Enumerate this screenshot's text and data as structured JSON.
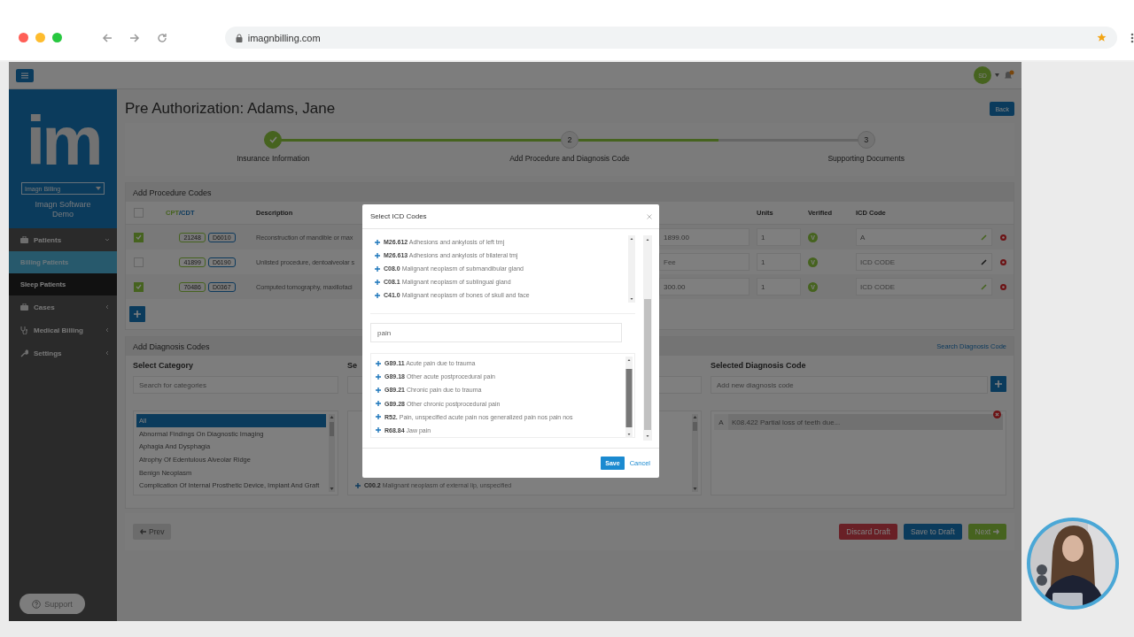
{
  "browser": {
    "url": "imagnbilling.com"
  },
  "header": {
    "initials": "SD"
  },
  "sidebar": {
    "logo": "im",
    "org_select": "Imagn Billing",
    "org_name": "Imagn Software Demo",
    "items": [
      {
        "label": "Patients",
        "expanded": true,
        "children": [
          {
            "label": "Billing Patients",
            "selected": true
          },
          {
            "label": "Sleep Patients",
            "selected": false
          }
        ]
      },
      {
        "label": "Cases",
        "expanded": false
      },
      {
        "label": "Medical Billing",
        "expanded": false
      },
      {
        "label": "Settings",
        "expanded": false
      }
    ],
    "support": "Support"
  },
  "page": {
    "title": "Pre Authorization: Adams, Jane",
    "back": "Back"
  },
  "steps": {
    "level": 0.75,
    "items": [
      {
        "label": "Insurance Information",
        "done": true
      },
      {
        "number": "2",
        "label": "Add Procedure and Diagnosis Code",
        "done": false
      },
      {
        "number": "3",
        "label": "Supporting Documents",
        "done": false
      }
    ]
  },
  "procedures": {
    "title": "Add Procedure Codes",
    "all_checked": false,
    "code_heading": {
      "cpt": "CPT",
      "cdt": "/CDT"
    },
    "columns": [
      "Description",
      "Units",
      "Verified",
      "ICD Code"
    ],
    "rows": [
      {
        "checked": true,
        "cpt": "21248",
        "cdt": "D6010",
        "description": "Reconstruction of mandible or max",
        "fee": "1899.00",
        "units": "1",
        "verified": "V",
        "icd": "A"
      },
      {
        "checked": false,
        "cpt": "41899",
        "cdt": "D6190",
        "description": "Unlisted procedure, dentoalveolar s",
        "fee_placeholder": "Fee",
        "units": "1",
        "verified": "V",
        "icd_placeholder": "ICD CODE"
      },
      {
        "checked": true,
        "cpt": "70486",
        "cdt": "D0367",
        "description": "Computed tomography, maxillofaci",
        "fee": "300.00",
        "units": "1",
        "verified": "V",
        "icd_placeholder": "ICD CODE"
      }
    ]
  },
  "diagnosis": {
    "title": "Add Diagnosis Codes",
    "search_link": "Search Diagnosis Code",
    "category": {
      "heading": "Select Category",
      "placeholder": "Search for categories",
      "items": [
        {
          "label": "All",
          "selected": true
        },
        {
          "label": "Abnormal Findings On Diagnostic Imaging",
          "selected": false
        },
        {
          "label": "Aphagia And Dysphagia",
          "selected": false
        },
        {
          "label": "Atrophy Of Edentulous Alveolar Ridge",
          "selected": false
        },
        {
          "label": "Benign Neoplasm",
          "selected": false
        },
        {
          "label": "Complication Of Internal Prosthetic Device, Implant And Graft",
          "selected": false
        }
      ]
    },
    "codes": {
      "heading": "Se",
      "items": [
        {
          "code": "C00.2",
          "text": "Malignant neoplasm of external lip, unspecified"
        }
      ]
    },
    "selected": {
      "heading": "Selected Diagnosis Code",
      "placeholder": "Add new diagnosis code",
      "items": [
        {
          "letter": "A",
          "text": "K08.422 Partial loss of teeth due..."
        }
      ]
    }
  },
  "footer": {
    "prev": "Prev",
    "discard": "Discard Draft",
    "save_draft": "Save to Draft",
    "next": "Next"
  },
  "modal": {
    "title": "Select ICD Codes",
    "list": [
      {
        "code": "M26.612",
        "text": "Adhesions and ankylosis of left tmj"
      },
      {
        "code": "M26.613",
        "text": "Adhesions and ankylosis of bilateral tmj"
      },
      {
        "code": "C08.0",
        "text": "Malignant neoplasm of submandibular gland"
      },
      {
        "code": "C08.1",
        "text": "Malignant neoplasm of sublingual gland"
      },
      {
        "code": "C41.0",
        "text": "Malignant neoplasm of bones of skull and face"
      }
    ],
    "search": {
      "value": "pain"
    },
    "results": [
      {
        "code": "G89.11",
        "text": "Acute pain due to trauma"
      },
      {
        "code": "G89.18",
        "text": "Other acute postprocedural pain"
      },
      {
        "code": "G89.21",
        "text": "Chronic pain due to trauma"
      },
      {
        "code": "G89.28",
        "text": "Other chronic postprocedural pain"
      },
      {
        "code": "R52.",
        "text": "Pain, unspecified acute pain nos generalized pain nos pain nos"
      },
      {
        "code": "R68.84",
        "text": "Jaw pain"
      }
    ],
    "save": "Save",
    "cancel": "Cancel"
  }
}
